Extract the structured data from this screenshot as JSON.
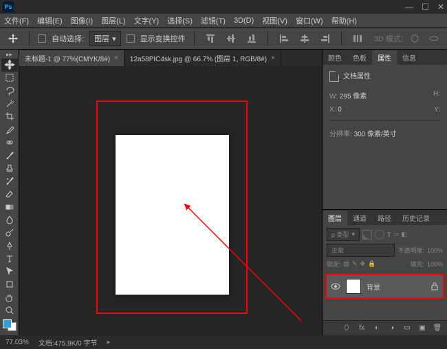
{
  "menu": {
    "file": "文件(F)",
    "edit": "编辑(E)",
    "image": "图像(I)",
    "layer": "图层(L)",
    "type": "文字(Y)",
    "select": "选择(S)",
    "filter": "滤镜(T)",
    "threeD": "3D(D)",
    "view": "视图(V)",
    "window": "窗口(W)",
    "help": "帮助(H)"
  },
  "options": {
    "autoSelect": "自动选择:",
    "autoSelectTarget": "图层",
    "showTransform": "显示变换控件",
    "threeDMode": "3D 模式:"
  },
  "tabs": {
    "active": "未标题-1 @ 77%(CMYK/8#)",
    "inactive": "12a58PIC4sk.jpg @ 66.7% (图层 1, RGB/8#)"
  },
  "propsTabs": {
    "color": "颜色",
    "swatches": "色板",
    "properties": "属性",
    "info": "信息"
  },
  "props": {
    "title": "文档属性",
    "wLabel": "W:",
    "wValue": "295 像素",
    "hLabel": "H:",
    "xLabel": "X:",
    "xValue": "0",
    "yLabel": "Y:",
    "resLabel": "分辨率:",
    "resValue": "300 像素/英寸"
  },
  "layersTabs": {
    "layers": "图层",
    "channels": "通道",
    "paths": "路径",
    "history": "历史记录"
  },
  "layersPanel": {
    "kind": "p 类型",
    "blend": "正常",
    "opacityLabel": "不透明度:",
    "opacityValue": "100%",
    "lockLabel": "锁定:",
    "fillLabel": "填充:",
    "fillValue": "100%",
    "bgLayerName": "背景"
  },
  "status": {
    "zoom": "77.03%",
    "docInfo": "文档:475.9K/0 字节"
  }
}
